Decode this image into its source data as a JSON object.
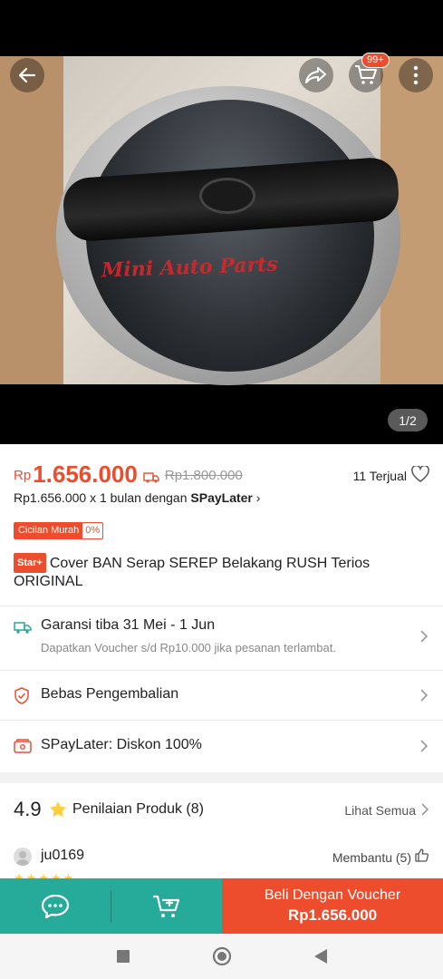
{
  "product": {
    "currency": "Rp",
    "price": "1.656.000",
    "original_price": "Rp1.800.000",
    "sold": "11 Terjual",
    "installment": "Rp1.656.000 x 1 bulan dengan",
    "installment_brand": "SPayLater",
    "cicilan_label": "Cicilan Murah",
    "cicilan_rate": "0%",
    "star_badge": "Star+",
    "title": "Cover BAN Serap SEREP Belakang RUSH Terios ORIGINAL",
    "watermark": "Mini Auto Parts"
  },
  "gallery": {
    "counter": "1/2"
  },
  "header": {
    "cart_badge": "99+"
  },
  "rows": {
    "shipping_title": "Garansi tiba 31 Mei - 1 Jun",
    "shipping_sub": "Dapatkan Voucher s/d Rp10.000 jika pesanan terlambat.",
    "returns": "Bebas Pengembalian",
    "spaylater": "SPayLater: Diskon 100%"
  },
  "rating": {
    "score": "4.9",
    "label": "Penilaian Produk",
    "count": "(8)",
    "see_all": "Lihat Semua",
    "reviewer": "ju0169",
    "helpful": "Membantu (5)",
    "review_stars": "★★★★★"
  },
  "actions": {
    "buy_line1": "Beli Dengan Voucher",
    "buy_line2": "Rp1.656.000"
  },
  "colors": {
    "accent": "#ee4d2d",
    "teal": "#26aa99",
    "star": "#ffce3d"
  }
}
